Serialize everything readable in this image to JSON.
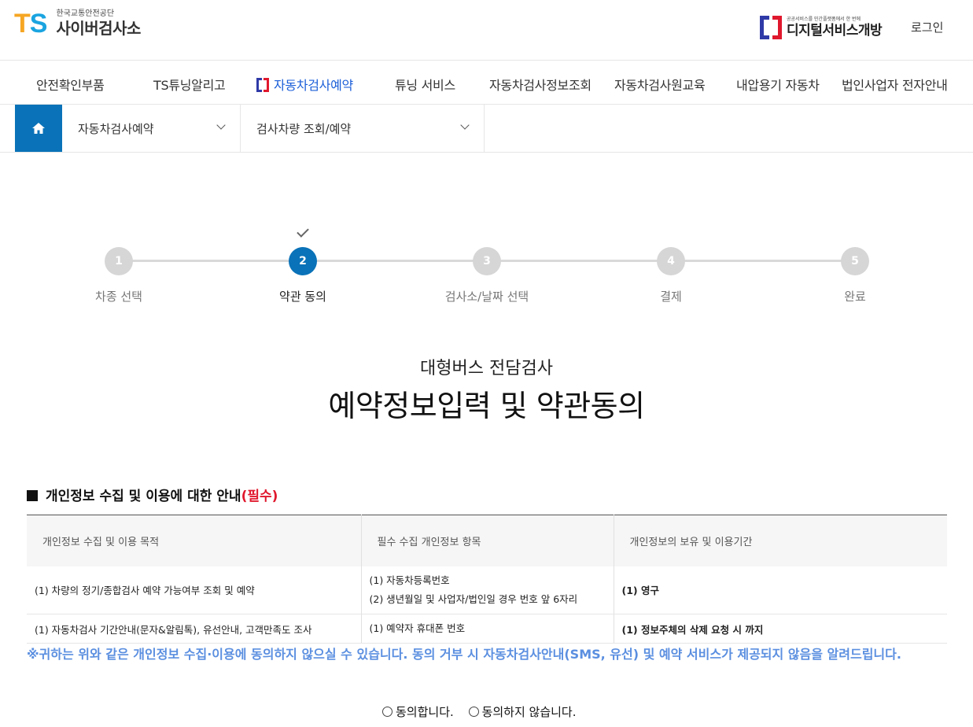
{
  "header": {
    "logo_mark": "TS",
    "logo_sub": "한국교통안전공단",
    "logo_main": "사이버검사소",
    "dgov_sub": "공공서비스를 민간플랫폼에서 한 번에",
    "dgov_main": "디지털서비스개방",
    "login": "로그인"
  },
  "gnb": {
    "items": [
      {
        "label": "안전확인부품"
      },
      {
        "label": "TS튜닝알리고"
      },
      {
        "label": "자동차검사예약"
      },
      {
        "label": "튜닝 서비스"
      },
      {
        "label": "자동차검사정보조회"
      },
      {
        "label": "자동차검사원교육"
      },
      {
        "label": "내압용기 자동차"
      },
      {
        "label": "법인사업자 전자안내"
      }
    ],
    "active_index": 2
  },
  "breadcrumb": {
    "level1": "자동차검사예약",
    "level2": "검사차량 조회/예약"
  },
  "steps": {
    "items": [
      {
        "num": "1",
        "label": "차종 선택"
      },
      {
        "num": "2",
        "label": "약관 동의"
      },
      {
        "num": "3",
        "label": "검사소/날짜 선택"
      },
      {
        "num": "4",
        "label": "결제"
      },
      {
        "num": "5",
        "label": "완료"
      }
    ],
    "current": 2
  },
  "page": {
    "subtitle": "대형버스 전담검사",
    "title": "예약정보입력 및 약관동의"
  },
  "privacy": {
    "heading": "개인정보 수집 및 이용에 대한 안내",
    "heading_required": "(필수)",
    "columns": [
      "개인정보 수집 및 이용 목적",
      "필수 수집 개인정보 항목",
      "개인정보의 보유 및 이용기간"
    ],
    "rows": [
      {
        "purpose": "(1) 차량의 정기/종합검사 예약 가능여부 조회 및 예약",
        "items": [
          "(1) 자동차등록번호",
          "(2) 생년월일 및 사업자/법인일 경우 번호 앞 6자리"
        ],
        "period": "(1) 영구"
      },
      {
        "purpose": "(1) 자동차검사 기간안내(문자&알림톡), 유선안내, 고객만족도 조사",
        "items": [
          "(1) 예약자 휴대폰 번호"
        ],
        "period": "(1) 정보주체의 삭제 요청 시 까지"
      }
    ],
    "notice": "※귀하는 위와 같은 개인정보 수집·이용에 동의하지 않으실 수 있습니다. 동의 거부 시 자동차검사안내(SMS, 유선) 및 예약 서비스가 제공되지 않음을 알려드립니다.",
    "agree_label": "동의합니다.",
    "disagree_label": "동의하지 않습니다."
  }
}
